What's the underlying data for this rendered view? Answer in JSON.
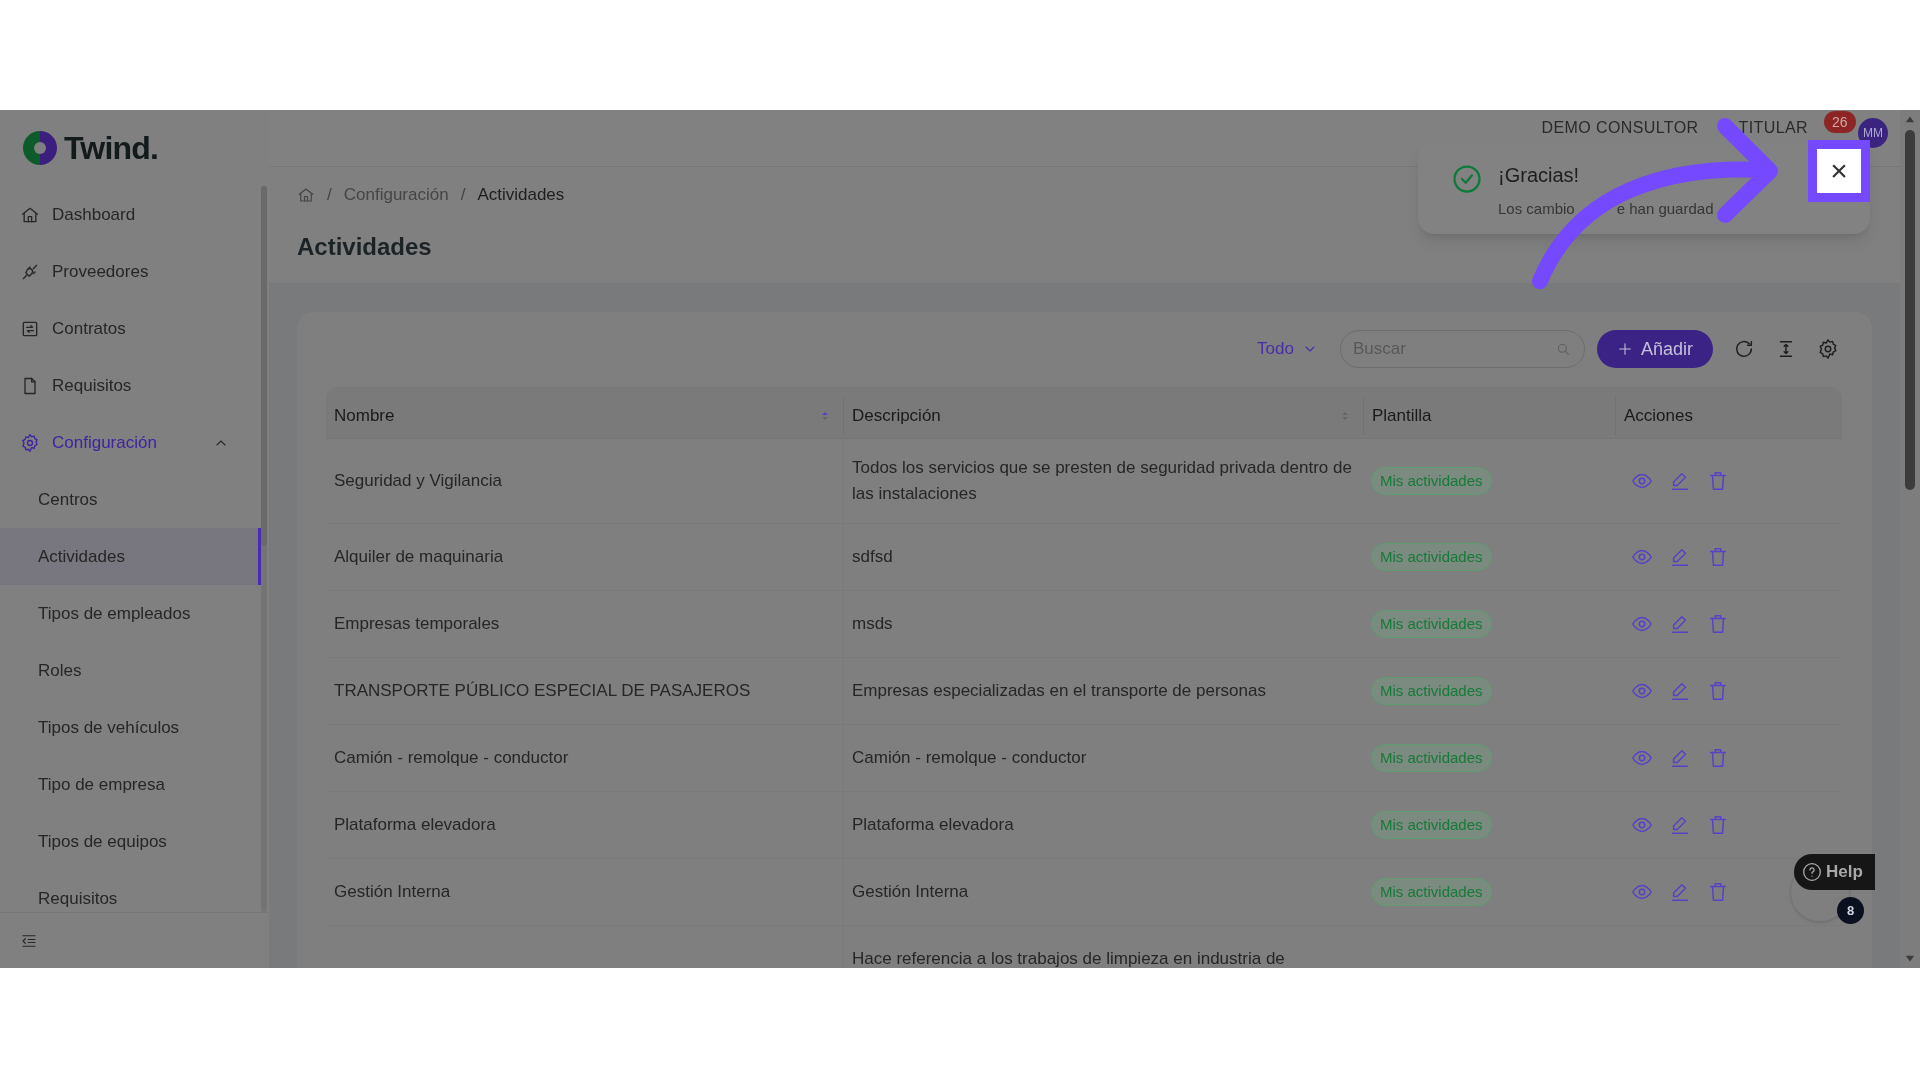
{
  "sidebar": {
    "logo": "Twind.",
    "items": [
      {
        "label": "Dashboard",
        "selected": false
      },
      {
        "label": "Proveedores",
        "selected": false
      },
      {
        "label": "Contratos",
        "selected": false
      },
      {
        "label": "Requisitos",
        "selected": false
      },
      {
        "label": "Configuración",
        "selected": true,
        "expanded": true,
        "children": [
          {
            "label": "Centros",
            "selected": false
          },
          {
            "label": "Actividades",
            "selected": true
          },
          {
            "label": "Tipos de empleados",
            "selected": false
          },
          {
            "label": "Roles",
            "selected": false
          },
          {
            "label": "Tipos de vehículos",
            "selected": false
          },
          {
            "label": "Tipo de empresa",
            "selected": false
          },
          {
            "label": "Tipos de equipos",
            "selected": false
          },
          {
            "label": "Requisitos",
            "selected": false
          }
        ]
      }
    ]
  },
  "header": {
    "account": [
      "DEMO CONSULTOR",
      "TITULAR"
    ],
    "avatar": "MM",
    "notifications": "26"
  },
  "breadcrumb": [
    {
      "separator": "/",
      "label": "Configuración"
    },
    {
      "separator": "/",
      "label": "Actividades"
    }
  ],
  "page_title": "Actividades",
  "toolbar": {
    "filter": "Todo",
    "search": {
      "placeholder": "Buscar"
    },
    "add_button": "Añadir"
  },
  "table": {
    "columns": [
      {
        "label": "Nombre",
        "sorted": true
      },
      {
        "label": "Descripción",
        "sorted": false
      },
      {
        "label": "Plantilla"
      },
      {
        "label": "Acciones"
      }
    ],
    "rows": [
      {
        "name": "Seguridad y Vigilancia",
        "description": "Todos los servicios que se presten de seguridad privada dentro de las instalaciones",
        "template": "Mis actividades"
      },
      {
        "name": "Alquiler de maquinaria",
        "description": "sdfsd",
        "template": "Mis actividades"
      },
      {
        "name": "Empresas temporales",
        "description": "msds",
        "template": "Mis actividades"
      },
      {
        "name": "TRANSPORTE PÚBLICO ESPECIAL DE PASAJEROS",
        "description": "Empresas especializadas en el transporte de personas",
        "template": "Mis actividades"
      },
      {
        "name": "Camión - remolque - conductor",
        "description": "Camión - remolque - conductor",
        "template": "Mis actividades"
      },
      {
        "name": "Plataforma elevadora",
        "description": "Plataforma elevadora",
        "template": "Mis actividades"
      },
      {
        "name": "Gestión Interna",
        "description": "Gestión Interna",
        "template": "Mis actividades"
      },
      {
        "description": "Hace referencia a los trabajos de limpieza en industria de"
      }
    ]
  },
  "toast": {
    "title": "¡Gracias!",
    "message": [
      "Los cambio",
      "e han guardad"
    ],
    "close": "×"
  },
  "help": {
    "label": "Help",
    "count": "8"
  }
}
